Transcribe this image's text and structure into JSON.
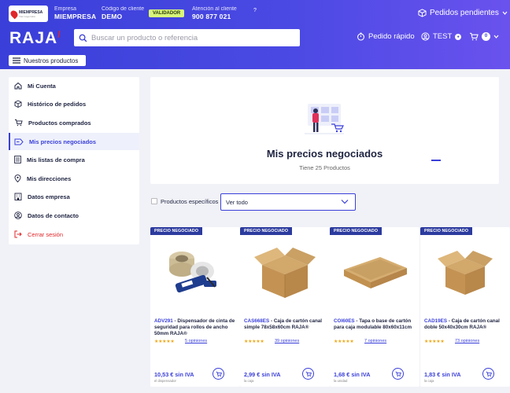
{
  "header": {
    "logo_badge_title": "MIEMPRESA",
    "logo_badge_sub": "Your Logo Here",
    "empresa_label": "Empresa",
    "empresa_value": "MIEMPRESA",
    "codigo_label": "Código de cliente",
    "codigo_value": "DEMO",
    "validador_label": "VALIDADOR",
    "atencion_label": "Atención al cliente",
    "atencion_phone": "900 877 021",
    "pedidos_pendientes": "Pedidos pendientes",
    "brand": "RAJA",
    "search_placeholder": "Buscar un producto o referencia",
    "pedido_rapido": "Pedido rápido",
    "user": "TEST",
    "cart_count": "0",
    "nuestros_productos": "Nuestros productos",
    "colors": {
      "primary": "#3a3fd9",
      "accent": "#6a52ee",
      "validador": "#d8f57a",
      "brand_red": "#e0262a"
    }
  },
  "sidebar": {
    "items": [
      {
        "label": "Mi Cuenta",
        "icon": "home-icon"
      },
      {
        "label": "Histórico de pedidos",
        "icon": "box-icon"
      },
      {
        "label": "Productos comprados",
        "icon": "cart-icon"
      },
      {
        "label": "Mis precios negociados",
        "icon": "price-tag-icon",
        "active": true
      },
      {
        "label": "Mis listas de compra",
        "icon": "list-icon"
      },
      {
        "label": "Mis direcciones",
        "icon": "location-icon"
      },
      {
        "label": "Datos empresa",
        "icon": "building-icon"
      },
      {
        "label": "Datos de contacto",
        "icon": "user-circle-icon"
      },
      {
        "label": "Cerrar sesión",
        "icon": "logout-icon"
      }
    ]
  },
  "main": {
    "title": "Mis precios negociados",
    "subtitle": "Tiene 25 Productos",
    "filter_label": "Productos específicos",
    "select_value": "Ver todo"
  },
  "products": [
    {
      "tag": "PRECIO NEGOCIADO",
      "code": "ADV291",
      "name": "Dispensador de cinta de seguridad para rollos de ancho 50mm RAJA®",
      "stars": "★★★★★",
      "reviews": "5 opiniones",
      "price": "10,53 € sin IVA",
      "unit": "el dispensador"
    },
    {
      "tag": "PRECIO NEGOCIADO",
      "code": "CAS668ES",
      "name": "Caja de cartón canal simple 78x58x60cm RAJA®",
      "stars": "★★★★★",
      "reviews": "39 opiniones",
      "price": "2,99 € sin IVA",
      "unit": "la caja"
    },
    {
      "tag": "PRECIO NEGOCIADO",
      "code": "COI60ES",
      "name": "Tapa o base de cartón para caja modulable 80x60x11cm",
      "stars": "★★★★★",
      "reviews": "7 opiniones",
      "price": "1,68 € sin IVA",
      "unit": "la unidad"
    },
    {
      "tag": "PRECIO NEGOCIADO",
      "code": "CAD19ES",
      "name": "Caja de cartón canal doble 50x40x30cm RAJA®",
      "stars": "★★★★★",
      "reviews": "73 opiniones",
      "price": "1,83 € sin IVA",
      "unit": "la caja"
    }
  ]
}
